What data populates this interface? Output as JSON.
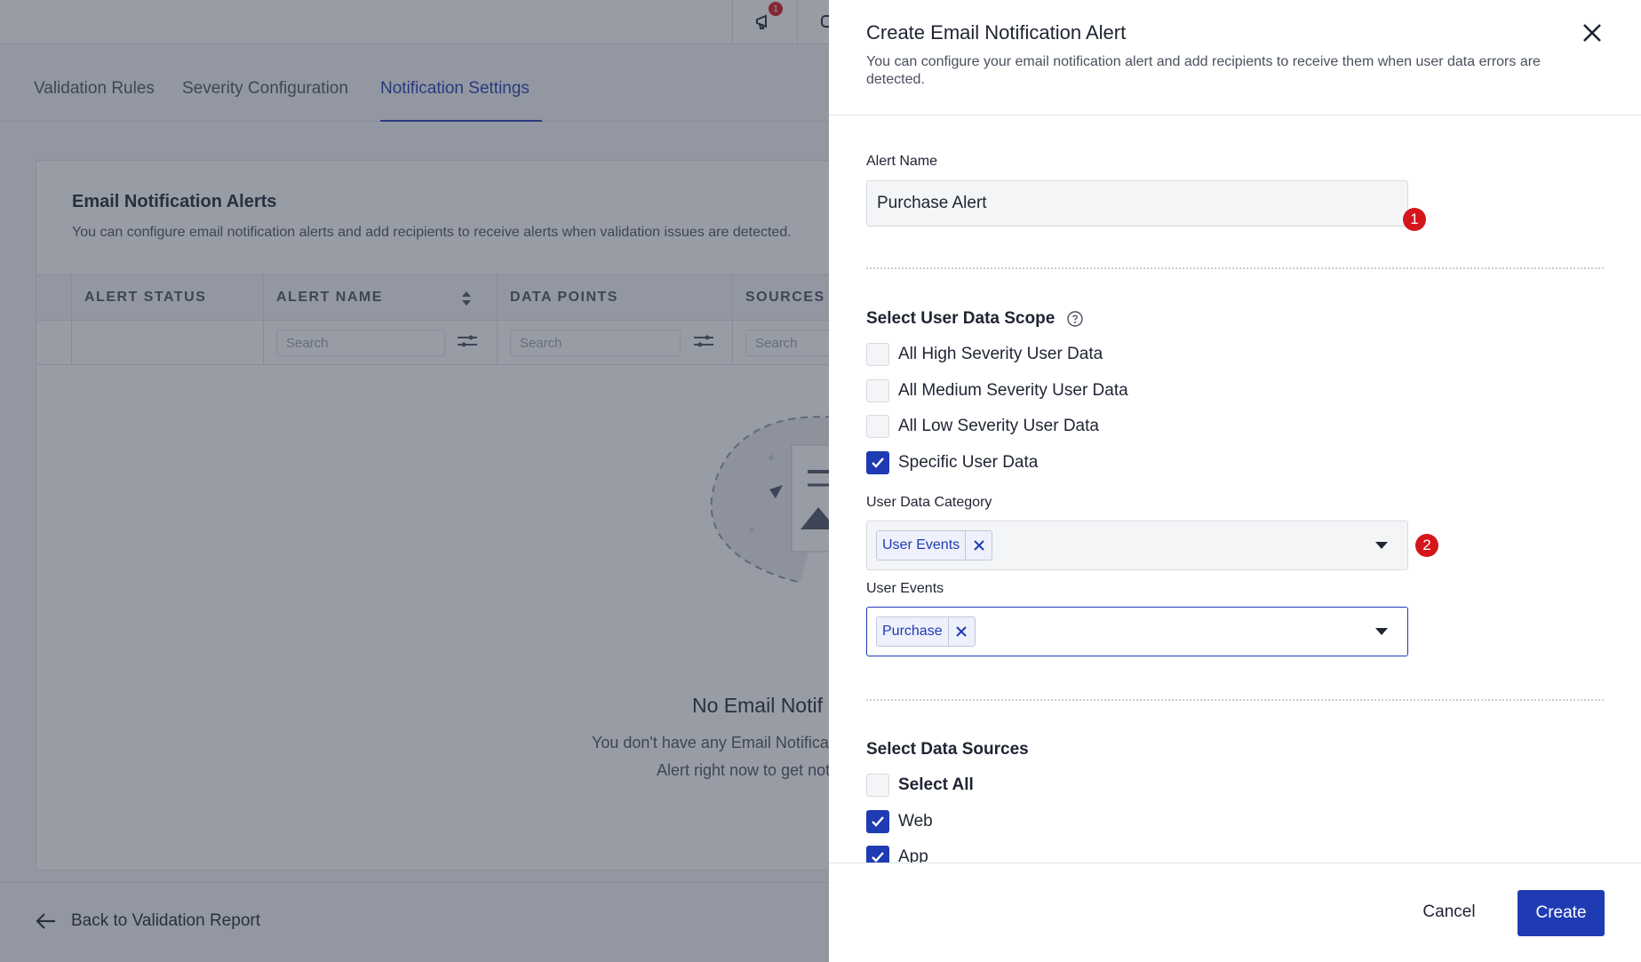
{
  "topbar": {
    "notification_count": "1"
  },
  "tabs": [
    {
      "label": "Validation Rules"
    },
    {
      "label": "Severity Configuration"
    },
    {
      "label": "Notification Settings"
    }
  ],
  "card": {
    "title": "Email Notification Alerts",
    "description": "You can configure email notification alerts and add recipients to receive alerts when validation issues are detected.",
    "columns": [
      "ALERT STATUS",
      "ALERT NAME",
      "DATA POINTS",
      "SOURCES"
    ],
    "search_placeholder": "Search",
    "empty_title": "No Email Notif",
    "empty_line1": "You don't have any Email Notificatio",
    "empty_line2": "Alert right now to get notifi"
  },
  "footer": {
    "back_label": "Back to Validation Report"
  },
  "drawer": {
    "title": "Create Email Notification Alert",
    "subtitle": "You can configure your email notification alert and add recipients to receive them when user data errors are detected.",
    "alert_name_label": "Alert Name",
    "alert_name_value": "Purchase Alert",
    "badge1": "1",
    "scope_title": "Select User Data Scope",
    "scope_options": [
      {
        "label": "All High Severity User Data",
        "checked": false
      },
      {
        "label": "All Medium Severity User Data",
        "checked": false
      },
      {
        "label": "All Low Severity User Data",
        "checked": false
      },
      {
        "label": "Specific User Data",
        "checked": true
      }
    ],
    "category_label": "User Data Category",
    "category_chip": "User Events",
    "badge2": "2",
    "events_label": "User Events",
    "events_chip": "Purchase",
    "sources_title": "Select Data Sources",
    "sources_options": [
      {
        "label": "Select All",
        "checked": false
      },
      {
        "label": "Web",
        "checked": true
      },
      {
        "label": "App",
        "checked": true
      }
    ],
    "cancel_label": "Cancel",
    "create_label": "Create"
  },
  "colors": {
    "primary": "#1f3bb3",
    "badge": "#d4161c"
  }
}
